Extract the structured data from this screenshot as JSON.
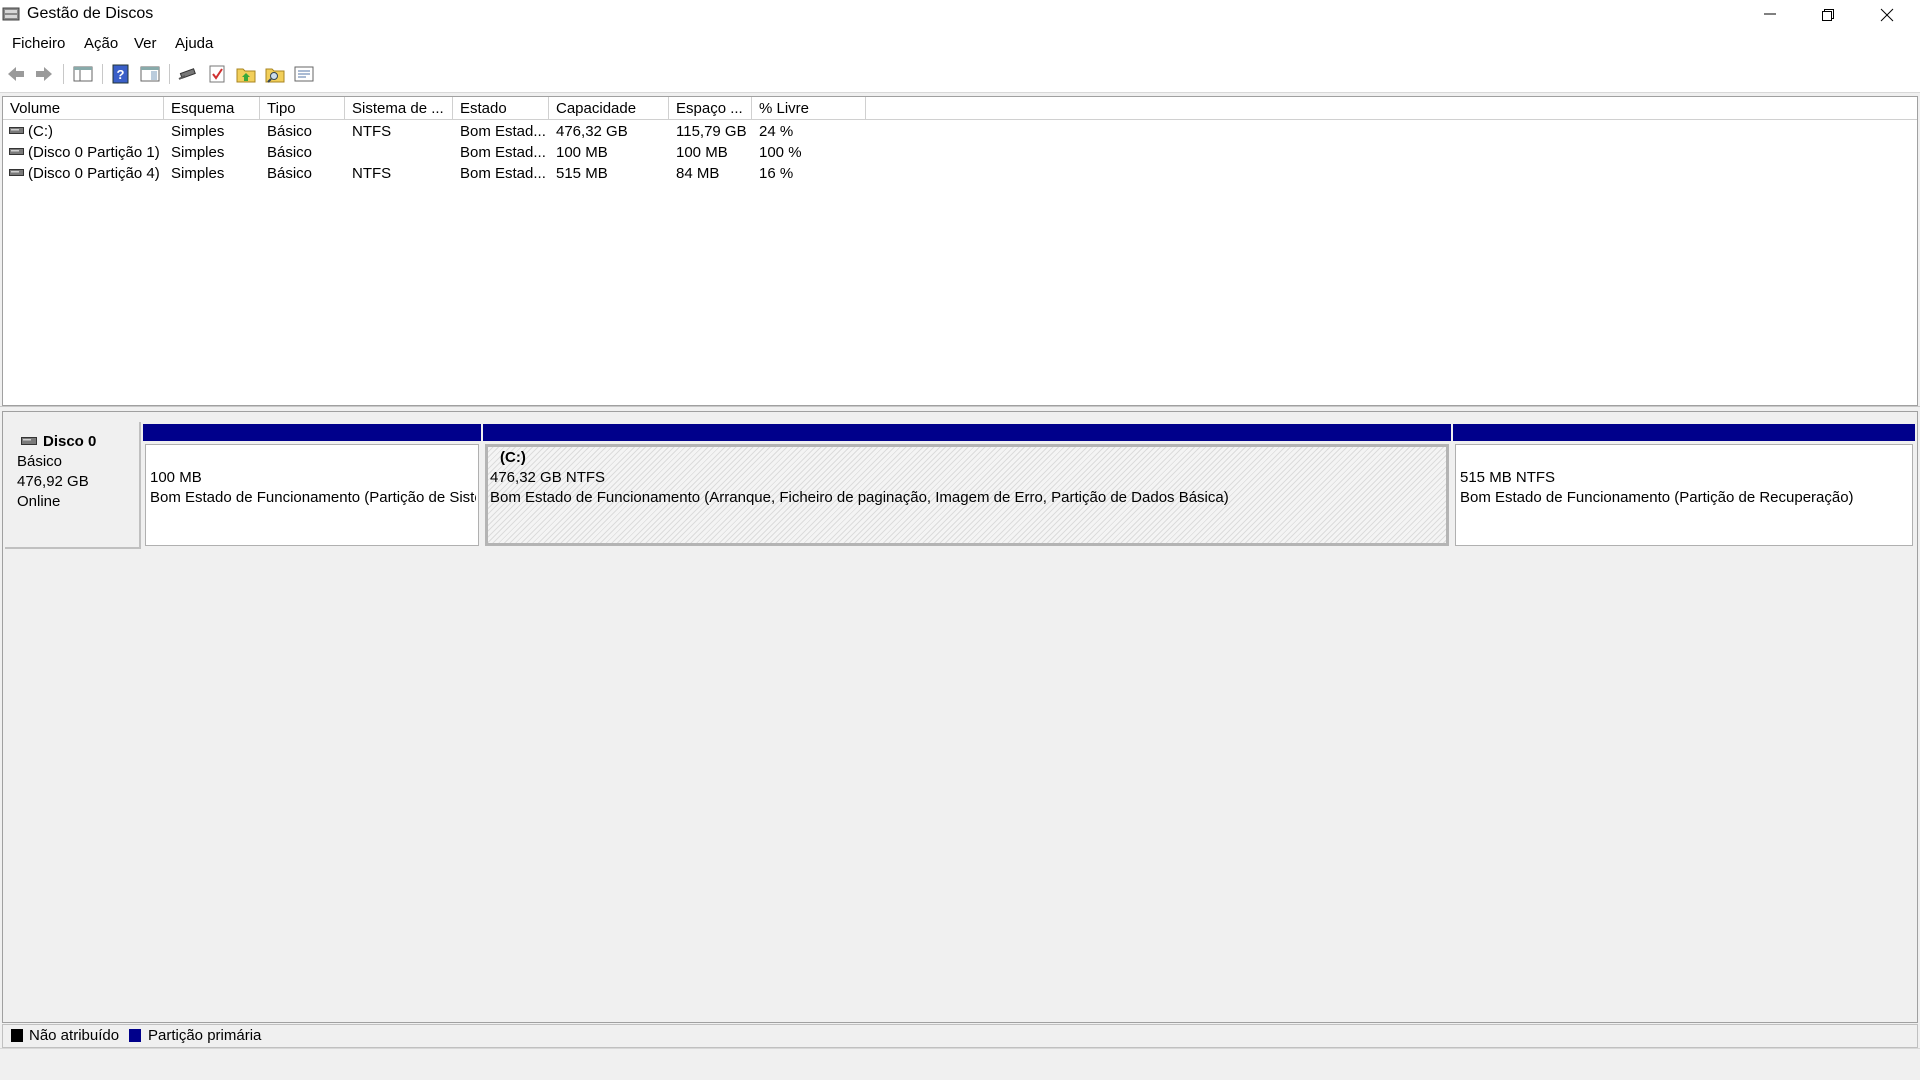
{
  "window": {
    "title": "Gestão de Discos",
    "controls": [
      "minimize",
      "restore",
      "close"
    ]
  },
  "menu": [
    "Ficheiro",
    "Ação",
    "Ver",
    "Ajuda"
  ],
  "toolbar": {
    "icons": [
      "back-arrow-icon",
      "forward-arrow-icon",
      "console-tree-icon",
      "help-icon",
      "properties-icon",
      "connect-icon",
      "check-icon",
      "folder-up-icon",
      "folder-search-icon",
      "settings-list-icon"
    ]
  },
  "volume_list": {
    "columns": [
      "Volume",
      "Esquema",
      "Tipo",
      "Sistema de ...",
      "Estado",
      "Capacidade",
      "Espaço ...",
      "% Livre"
    ],
    "rows": [
      [
        "(C:)",
        "Simples",
        "Básico",
        "NTFS",
        "Bom Estad...",
        "476,32 GB",
        "115,79 GB",
        "24 %"
      ],
      [
        "(Disco 0 Partição 1)",
        "Simples",
        "Básico",
        "",
        "Bom Estad...",
        "100 MB",
        "100 MB",
        "100 %"
      ],
      [
        "(Disco 0 Partição 4)",
        "Simples",
        "Básico",
        "NTFS",
        "Bom Estad...",
        "515 MB",
        "84 MB",
        "16 %"
      ]
    ]
  },
  "disk": {
    "name": "Disco 0",
    "type": "Básico",
    "size": "476,92 GB",
    "status": "Online",
    "partitions": [
      {
        "name": "",
        "size": "100 MB",
        "status": "Bom Estado de Funcionamento (Partição de Sistema EFI)"
      },
      {
        "name": "(C:)",
        "size": "476,32 GB NTFS",
        "status": "Bom Estado de Funcionamento (Arranque, Ficheiro de paginação, Imagem de Erro, Partição de Dados Básica)"
      },
      {
        "name": "",
        "size": "515 MB NTFS",
        "status": "Bom Estado de Funcionamento (Partição de Recuperação)"
      }
    ]
  },
  "legend": [
    {
      "label": "Não atribuído",
      "color": "#000000"
    },
    {
      "label": "Partição primária",
      "color": "#00008b"
    }
  ],
  "colors": {
    "primary_partition": "#00008b",
    "unallocated": "#000000"
  }
}
